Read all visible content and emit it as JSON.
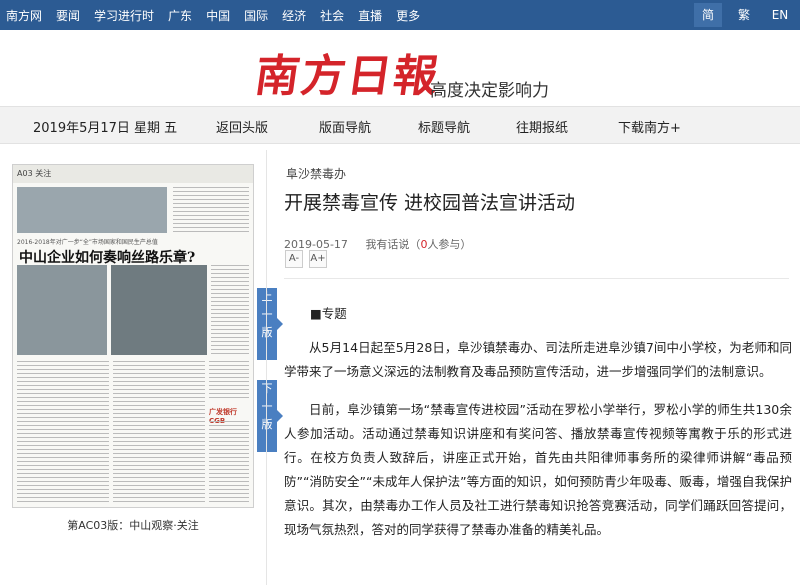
{
  "topnav": {
    "links": [
      "南方网",
      "要闻",
      "学习进行时",
      "广东",
      "中国",
      "国际",
      "经济",
      "社会",
      "直播",
      "更多"
    ],
    "lang": [
      "简",
      "繁",
      "EN"
    ]
  },
  "masthead": {
    "logo": "南方日報",
    "slogan": "高度决定影响力"
  },
  "subnav": {
    "date": "2019年5月17日 星期 五",
    "items": [
      "返回头版",
      "版面导航",
      "标题导航",
      "往期报纸",
      "下载南方+"
    ]
  },
  "paper": {
    "header": "A03 关注",
    "banner_sub": "2016-2018年对广一步“全”市场国家和国民生产总值",
    "banner": "中山企业如何奏响丝路乐章?",
    "ads": [
      "广发银行 CGB"
    ],
    "caption": "第AC03版：中山观察·关注"
  },
  "page_buttons": {
    "prev": [
      "上",
      "一",
      "版"
    ],
    "next": [
      "下",
      "一",
      "版"
    ]
  },
  "article": {
    "source": "阜沙禁毒办",
    "title": "开展禁毒宣传 进校园普法宣讲活动",
    "date": "2019-05-17",
    "comment_label": "我有话说（",
    "comment_count": "0",
    "comment_suffix": "人参与）",
    "font_minus": "A-",
    "font_plus": "A+",
    "topic": "■专题",
    "paragraphs": [
      "从5月14日起至5月28日，阜沙镇禁毒办、司法所走进阜沙镇7间中小学校，为老师和同学带来了一场意义深远的法制教育及毒品预防宣传活动，进一步增强同学们的法制意识。",
      "日前，阜沙镇第一场“禁毒宣传进校园”活动在罗松小学举行，罗松小学的师生共130余人参加活动。活动通过禁毒知识讲座和有奖问答、播放禁毒宣传视频等寓教于乐的形式进行。在校方负责人致辞后，讲座正式开始，首先由共阳律师事务所的梁律师讲解“毒品预防”“消防安全”“未成年人保护法”等方面的知识，如何预防青少年吸毒、贩毒，增强自我保护意识。其次，由禁毒办工作人员及社工进行禁毒知识抢答竞赛活动，同学们踊跃回答提问，现场气氛热烈，答对的同学获得了禁毒办准备的精美礼品。"
    ]
  }
}
